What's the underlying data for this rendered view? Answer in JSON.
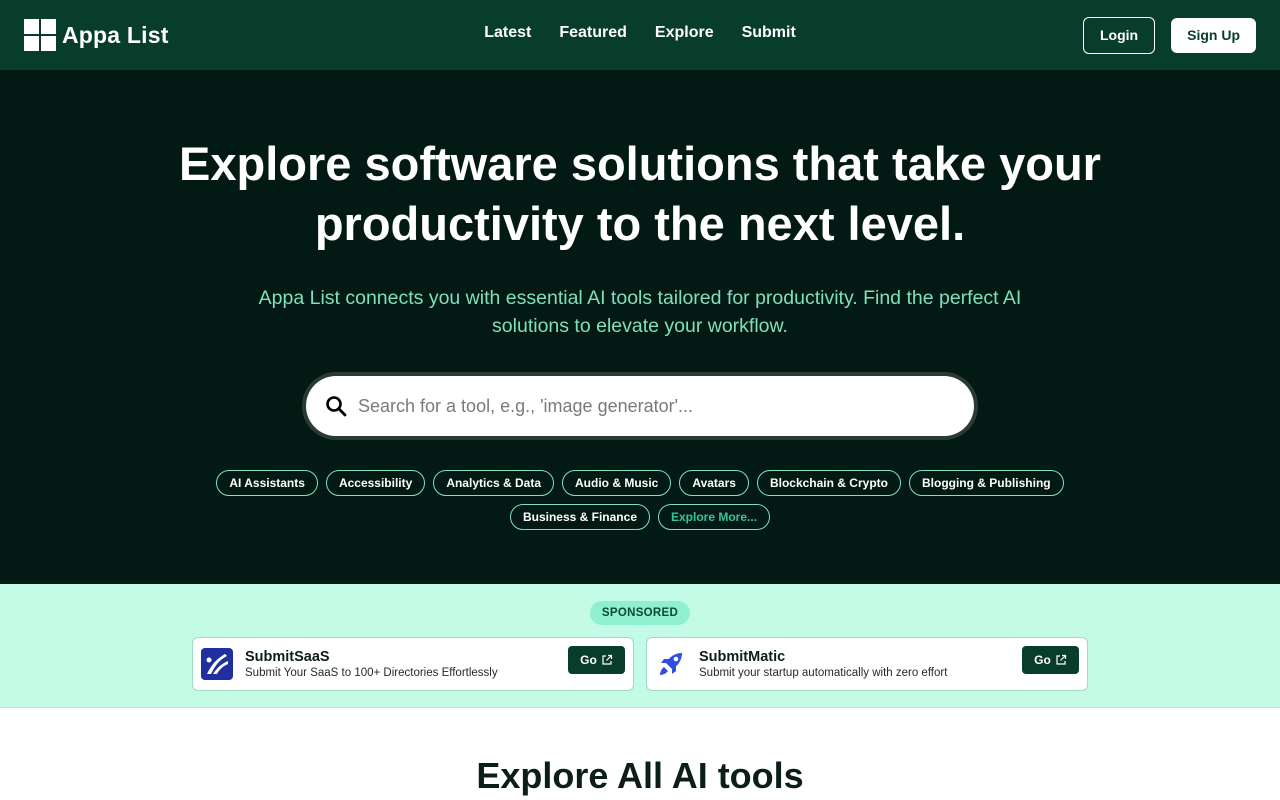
{
  "brand": {
    "name": "Appa List"
  },
  "nav": {
    "items": [
      "Latest",
      "Featured",
      "Explore",
      "Submit"
    ]
  },
  "auth": {
    "login": "Login",
    "signup": "Sign Up"
  },
  "hero": {
    "title": "Explore software solutions that take your productivity to the next level.",
    "subtitle": "Appa List connects you with essential AI tools tailored for productivity. Find the perfect AI solutions to elevate your workflow.",
    "search_placeholder": "Search for a tool, e.g., 'image generator'...",
    "categories": [
      "AI Assistants",
      "Accessibility",
      "Analytics & Data",
      "Audio & Music",
      "Avatars",
      "Blockchain & Crypto",
      "Blogging & Publishing",
      "Business & Finance"
    ],
    "explore_more": "Explore More..."
  },
  "sponsored": {
    "badge": "SPONSORED",
    "cards": [
      {
        "title": "SubmitSaaS",
        "desc": "Submit Your SaaS to 100+ Directories Effortlessly",
        "go": "Go",
        "icon": "submitsaas-logo-icon"
      },
      {
        "title": "SubmitMatic",
        "desc": "Submit your startup automatically with zero effort",
        "go": "Go",
        "icon": "rocket-logo-icon"
      }
    ]
  },
  "explore": {
    "title": "Explore All AI tools"
  },
  "colors": {
    "header": "#083d2c",
    "hero": "#021a13",
    "accent": "#7fe0c0",
    "sponsored_bg": "#c4fbe6"
  }
}
